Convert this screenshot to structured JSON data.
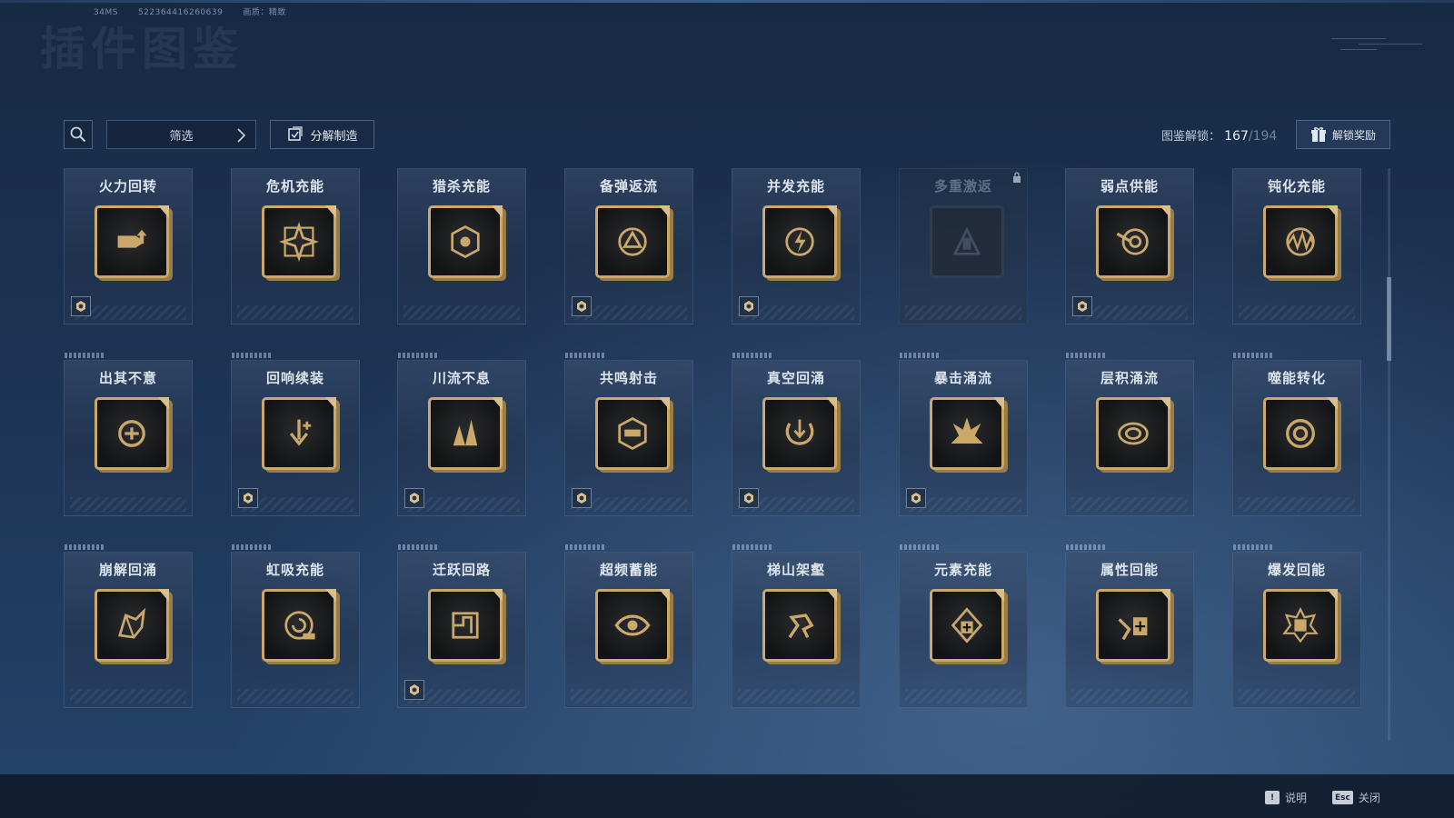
{
  "header": {
    "ping": "34MS",
    "uid": "522364416260639",
    "quality_label": "画质：精致",
    "page_title": "插件图鉴"
  },
  "toolbar": {
    "filter_label": "筛选",
    "dismantle_label": "分解制造",
    "unlock_label": "图鉴解锁：",
    "unlock_current": "167",
    "unlock_total": "/194",
    "reward_label": "解锁奖励"
  },
  "cards": [
    {
      "name": "火力回转",
      "icon": "bullet-up-icon",
      "badge": true
    },
    {
      "name": "危机充能",
      "icon": "diamond-star-icon",
      "badge": false
    },
    {
      "name": "猎杀充能",
      "icon": "target-hexagon-icon",
      "badge": false
    },
    {
      "name": "备弹返流",
      "icon": "cycle-triangle-icon",
      "badge": true
    },
    {
      "name": "并发充能",
      "icon": "crosshair-bolt-icon",
      "badge": true
    },
    {
      "name": "多重激返",
      "icon": "burst-bullet-icon",
      "badge": false,
      "locked": true
    },
    {
      "name": "弱点供能",
      "icon": "target-arrow-icon",
      "badge": true
    },
    {
      "name": "钝化充能",
      "icon": "wave-orb-icon",
      "badge": false
    },
    {
      "name": "出其不意",
      "icon": "fist-swirl-icon",
      "badge": false
    },
    {
      "name": "回响续装",
      "icon": "arrow-down-plus-icon",
      "badge": true
    },
    {
      "name": "川流不息",
      "icon": "triple-spike-icon",
      "badge": true
    },
    {
      "name": "共鸣射击",
      "icon": "gun-hexagon-icon",
      "badge": true
    },
    {
      "name": "真空回涌",
      "icon": "vortex-arrows-icon",
      "badge": true
    },
    {
      "name": "暴击涌流",
      "icon": "explosion-icon",
      "badge": true
    },
    {
      "name": "层积涌流",
      "icon": "ripple-blob-icon",
      "badge": false
    },
    {
      "name": "噬能转化",
      "icon": "swirl-ring-icon",
      "badge": false
    },
    {
      "name": "崩解回涌",
      "icon": "shatter-icon",
      "badge": false
    },
    {
      "name": "虹吸充能",
      "icon": "spiral-battery-icon",
      "badge": false
    },
    {
      "name": "迁跃回路",
      "icon": "circuit-icon",
      "badge": true
    },
    {
      "name": "超频蓄能",
      "icon": "eye-swirl-icon",
      "badge": false
    },
    {
      "name": "梯山架壑",
      "icon": "leap-figure-icon",
      "badge": false
    },
    {
      "name": "元素充能",
      "icon": "medkit-arrow-icon",
      "badge": false
    },
    {
      "name": "属性回能",
      "icon": "heart-medkit-icon",
      "badge": false
    },
    {
      "name": "爆发回能",
      "icon": "burst-medkit-icon",
      "badge": false
    }
  ],
  "footer": {
    "help_key": "!",
    "help_label": "说明",
    "close_key": "Esc",
    "close_label": "关闭"
  },
  "colors": {
    "gold": "#c9a86a",
    "icon_bg": "#141517",
    "background": "#1c3353"
  }
}
